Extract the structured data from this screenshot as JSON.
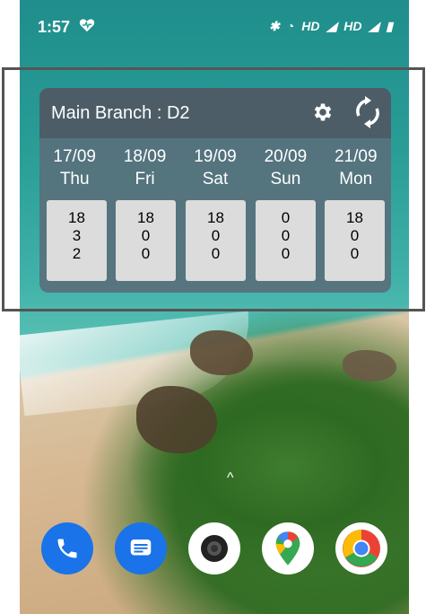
{
  "status_bar": {
    "time": "1:57",
    "icons": [
      "heart-icon",
      "bluetooth-icon",
      "wifi-icon",
      "hd-label",
      "signal-icon",
      "hd-label",
      "signal-icon",
      "battery-icon"
    ],
    "hd_label_1": "HD",
    "hd_label_2": "HD"
  },
  "widget": {
    "title": "Main Branch : D2",
    "days": [
      {
        "date": "17/09",
        "weekday": "Thu",
        "values": [
          "18",
          "3",
          "2"
        ]
      },
      {
        "date": "18/09",
        "weekday": "Fri",
        "values": [
          "18",
          "0",
          "0"
        ]
      },
      {
        "date": "19/09",
        "weekday": "Sat",
        "values": [
          "18",
          "0",
          "0"
        ]
      },
      {
        "date": "20/09",
        "weekday": "Sun",
        "values": [
          "0",
          "0",
          "0"
        ]
      },
      {
        "date": "21/09",
        "weekday": "Mon",
        "values": [
          "18",
          "0",
          "0"
        ]
      }
    ]
  },
  "home": {
    "drawer_hint": "^",
    "dock": [
      "phone-app-icon",
      "messages-app-icon",
      "camera-app-icon",
      "maps-app-icon",
      "chrome-app-icon"
    ]
  },
  "colors": {
    "widget_body": "#58707c",
    "widget_header": "#4c5d67",
    "card": "#dcdcdc"
  }
}
